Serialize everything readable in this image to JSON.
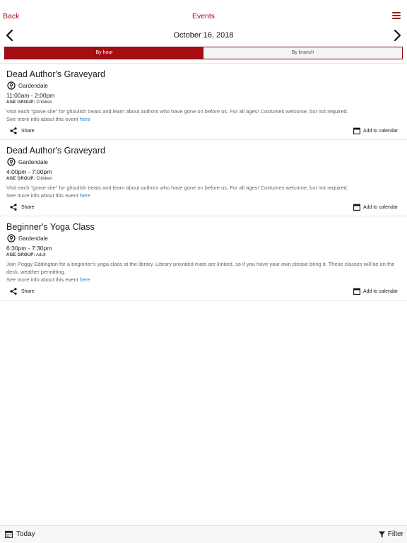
{
  "header": {
    "back_label": "Back",
    "title": "Events",
    "menu_icon": "hamburger-menu-icon",
    "accent_color": "#a50d13"
  },
  "date_nav": {
    "date": "October 16, 2018",
    "prev_icon": "chevron-left-icon",
    "next_icon": "chevron-right-icon"
  },
  "tabs": [
    {
      "label": "By hour",
      "active": true
    },
    {
      "label": "By branch",
      "active": false
    }
  ],
  "events": [
    {
      "title": "Dead Author's Graveyard",
      "location": "Gardendale",
      "time": "11:00am - 2:00pm",
      "age_label": "AGE GROUP:",
      "age_value": "Children",
      "description": "Visit each \"grave site\" for ghoulish treats and learn about authors who have gone on before us. For all ages! Costumes welcome, but not required.",
      "more_prefix": "See more info about this event",
      "more_link": "here",
      "share_label": "Share",
      "calendar_label": "Add to calendar"
    },
    {
      "title": "Dead Author's Graveyard",
      "location": "Gardendale",
      "time": "4:00pm - 7:00pm",
      "age_label": "AGE GROUP:",
      "age_value": "Children",
      "description": "Visit each \"grave site\" for ghoulish treats and learn about authors who have gone on before us. For all ages! Costumes welcome, but not required.",
      "more_prefix": "See more info about this event",
      "more_link": "here",
      "share_label": "Share",
      "calendar_label": "Add to calendar"
    },
    {
      "title": "Beginner's Yoga Class",
      "location": "Gardendale",
      "time": "6:30pm - 7:30pm",
      "age_label": "AGE GROUP:",
      "age_value": "Adult",
      "description": "Join Peggy Eddington for a beginner's yoga class at the library. Library provided mats are limited, so if you have your own please bring it. These classes will be on the deck, weather permitting.",
      "more_prefix": "See more info about this event",
      "more_link": "here",
      "share_label": "Share",
      "calendar_label": "Add to calendar"
    }
  ],
  "footer": {
    "today_label": "Today",
    "today_icon": "calendar-icon",
    "filter_label": "Filter",
    "filter_icon": "funnel-icon"
  }
}
